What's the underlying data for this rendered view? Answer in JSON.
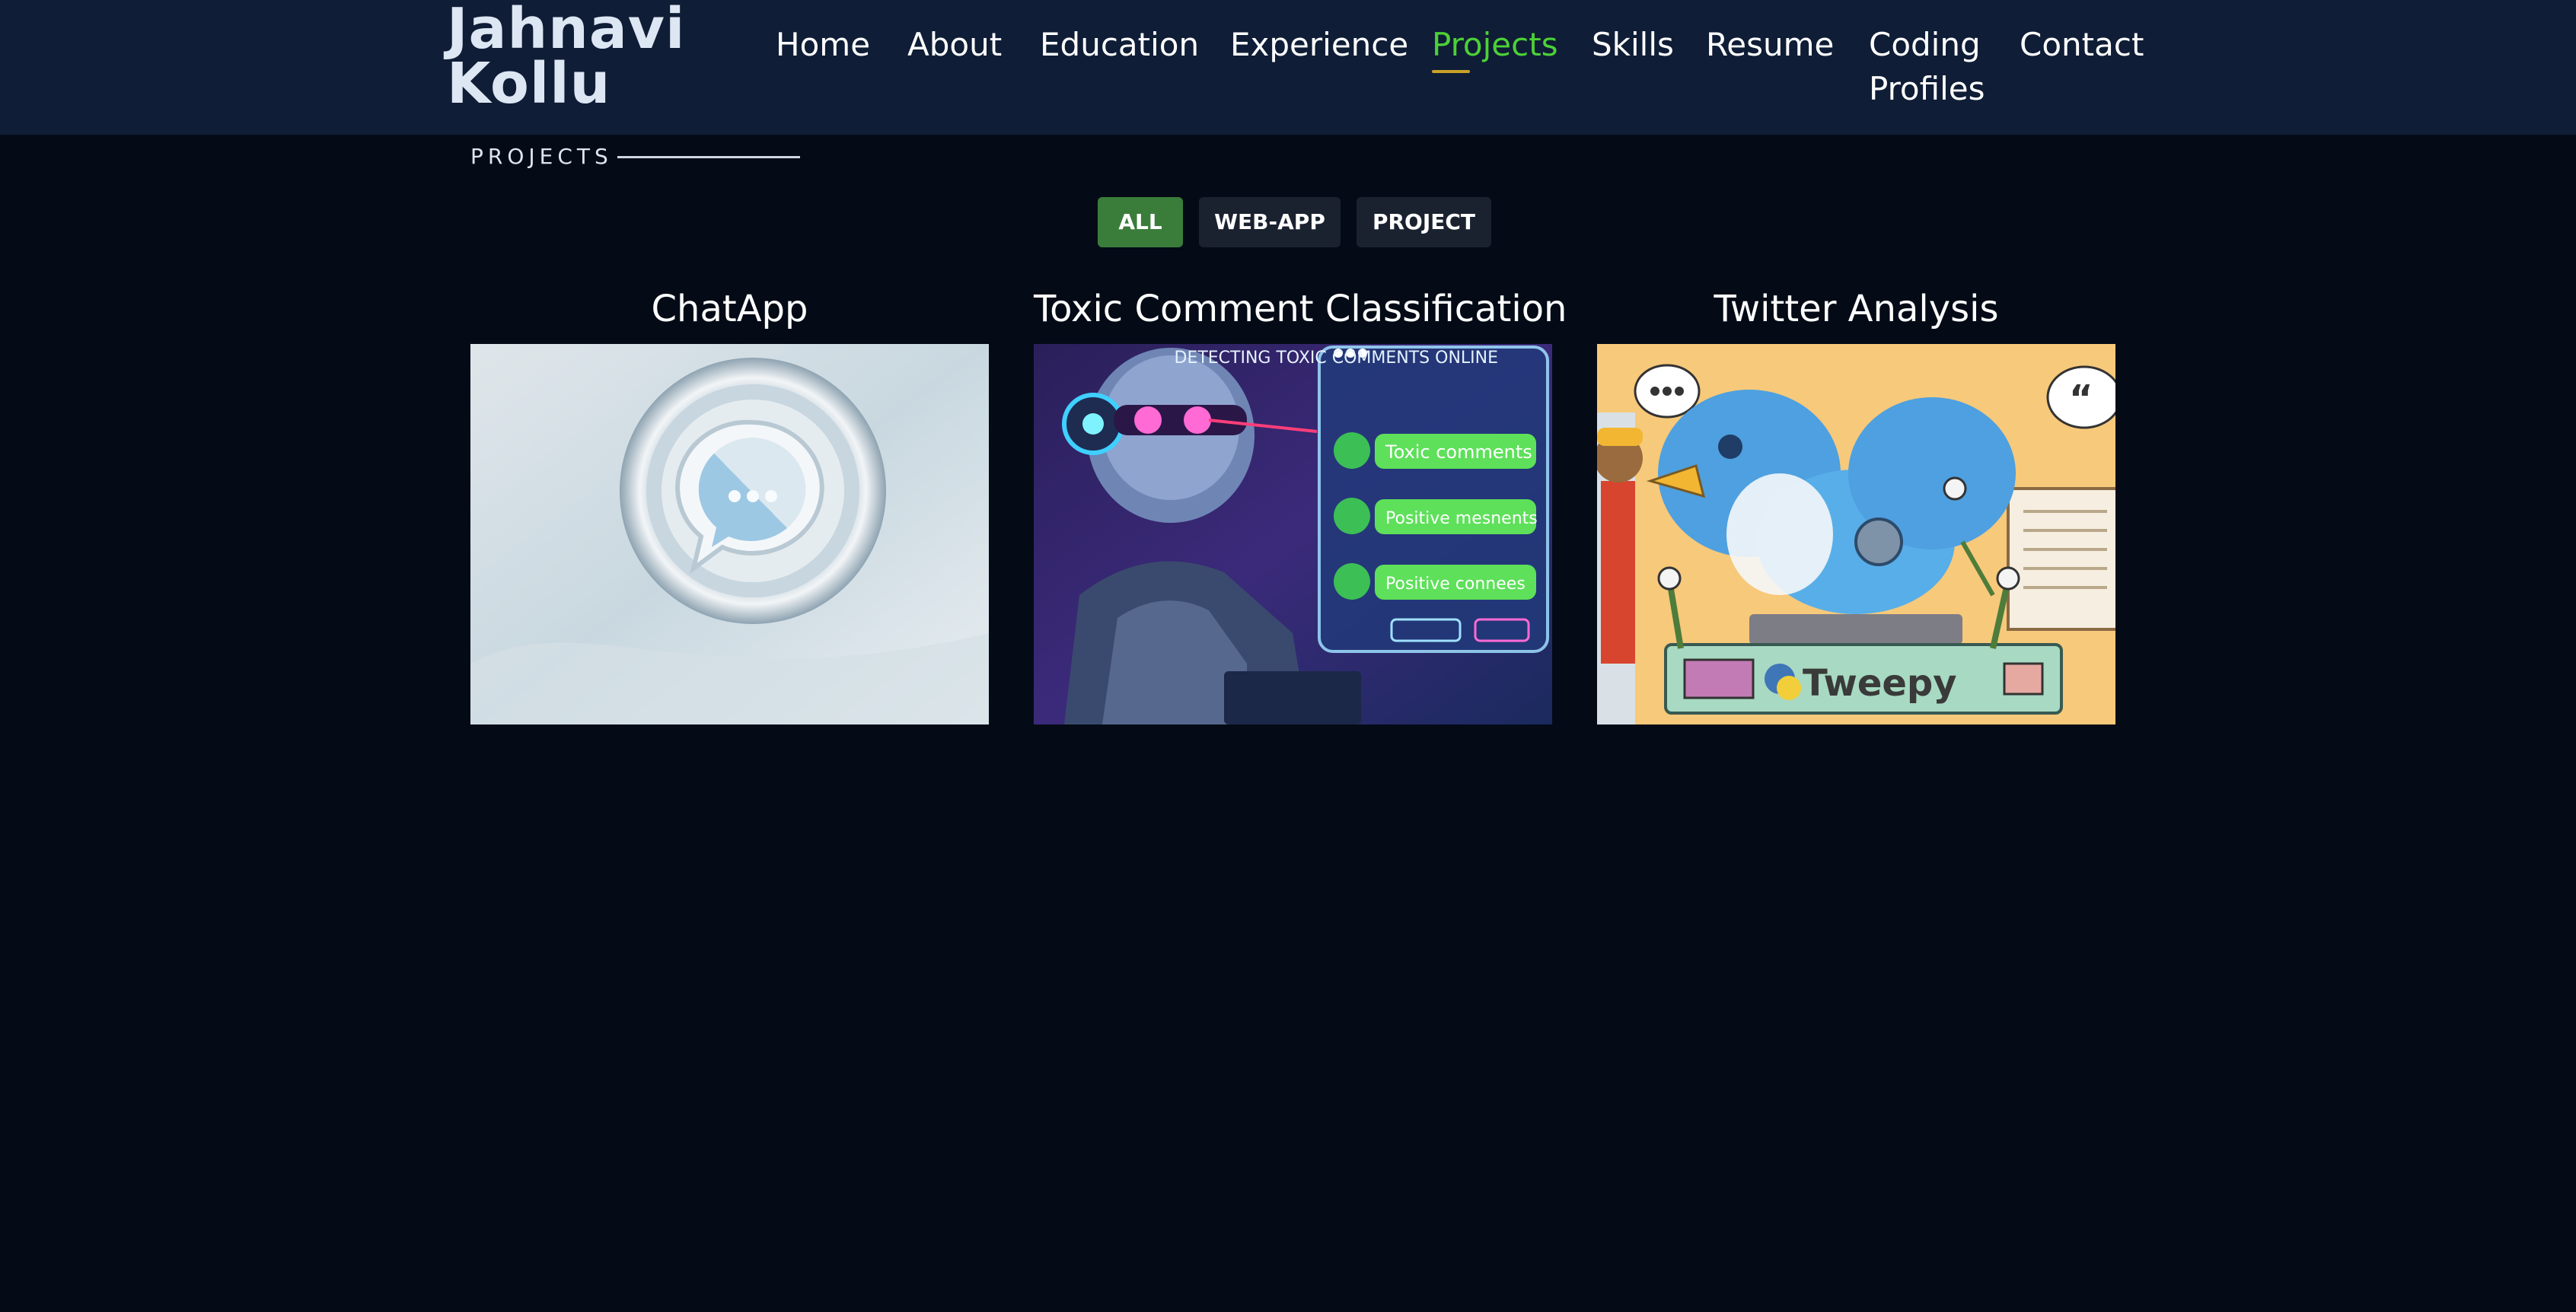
{
  "brand": {
    "name_line1": "Jahnavi",
    "name_line2": "Kollu"
  },
  "nav": {
    "items": [
      {
        "label": "Home"
      },
      {
        "label": "About"
      },
      {
        "label": "Education"
      },
      {
        "label": "Experience"
      },
      {
        "label": "Projects",
        "active": true
      },
      {
        "label": "Skills"
      },
      {
        "label": "Resume"
      },
      {
        "label": "Coding Profiles"
      },
      {
        "label": "Contact"
      }
    ],
    "active_color": "#4cd137"
  },
  "section": {
    "title": "PROJECTS"
  },
  "filters": [
    {
      "label": "ALL",
      "active": true
    },
    {
      "label": "WEB-APP"
    },
    {
      "label": "PROJECT"
    }
  ],
  "projects": [
    {
      "title": "ChatApp",
      "image_icon": "chat-bubble-icon"
    },
    {
      "title": "Toxic Comment Classification",
      "image_icon": "robot-toxic-comments-icon",
      "image_text": {
        "header": "DETECTING TOXIC COMMENTS ONLINE",
        "items": [
          "Toxic comments",
          "Positive mesnents",
          "Positive connees"
        ]
      }
    },
    {
      "title": "Twitter Analysis",
      "image_icon": "twitter-bird-icon",
      "image_text": {
        "label": "Tweepy"
      }
    }
  ],
  "colors": {
    "background": "#040b16",
    "header": "#0f1d36",
    "filter_active": "#3a7d3b",
    "filter_default": "#1a2230"
  }
}
